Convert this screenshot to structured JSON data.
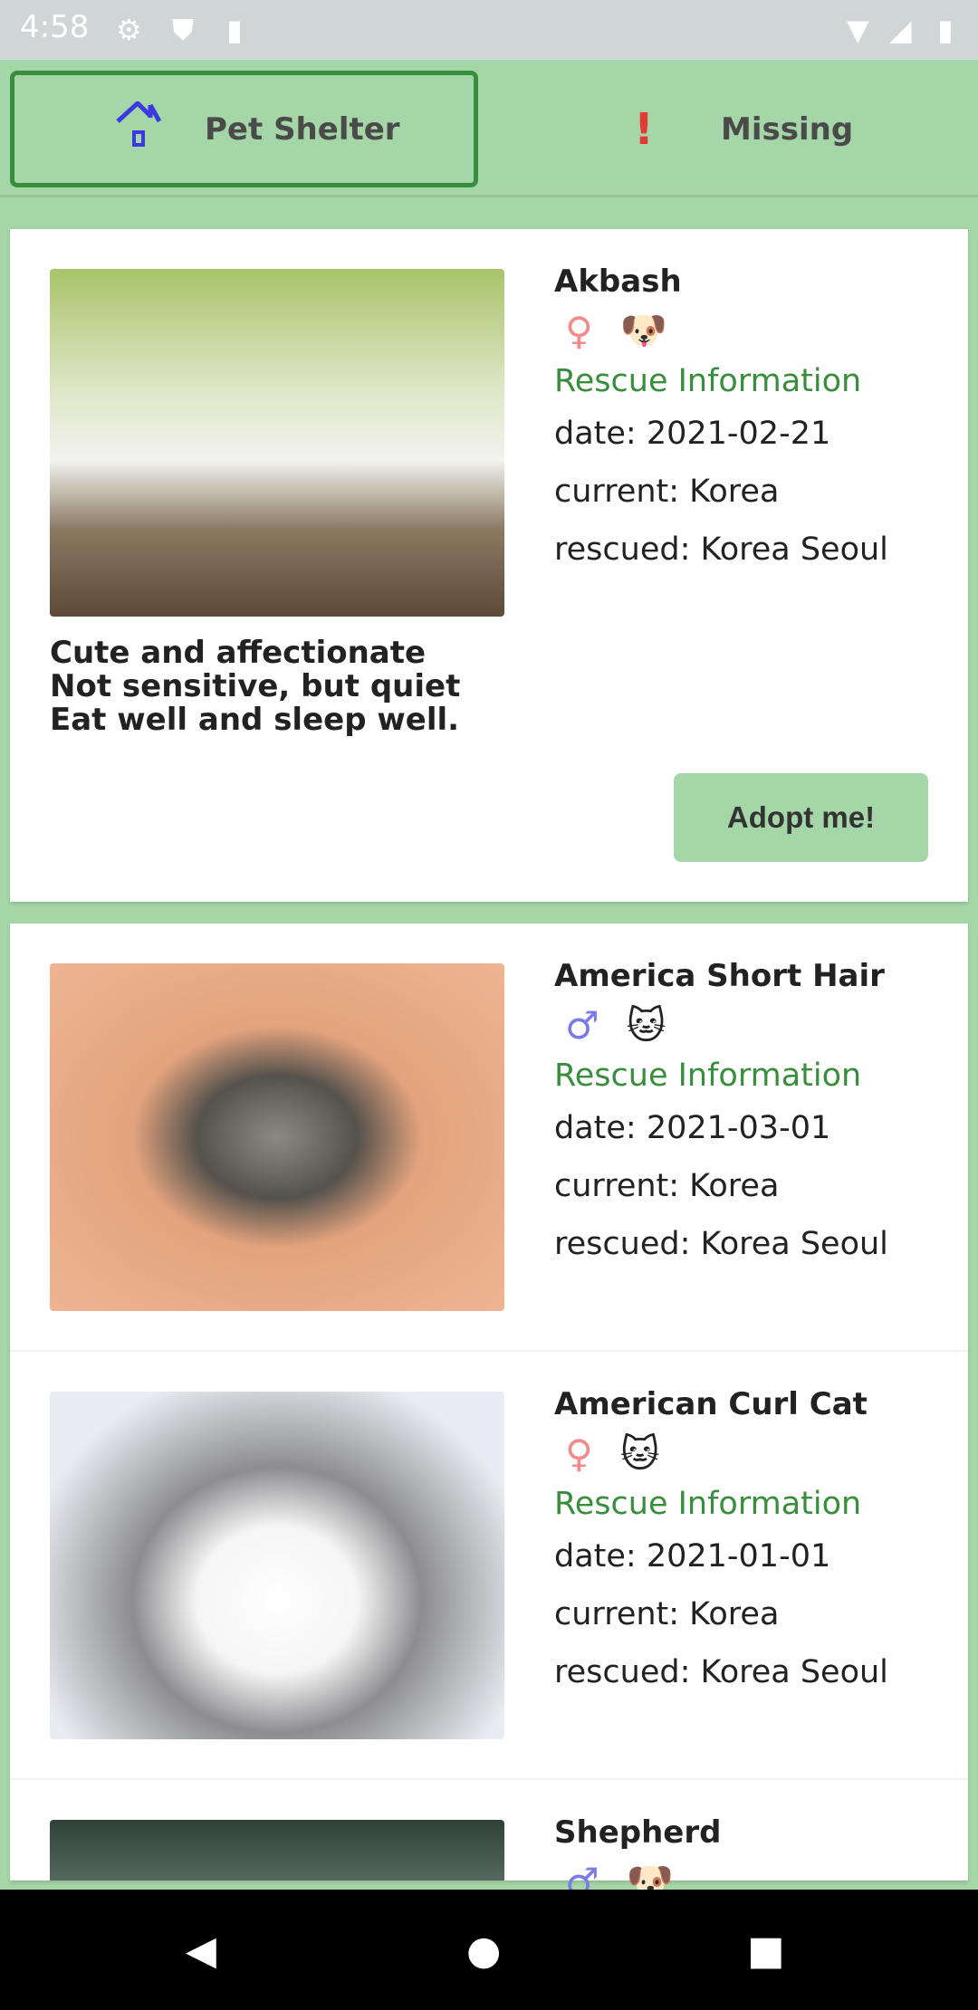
{
  "status_bar": {
    "time": "4:58",
    "icons": [
      "gear-icon",
      "shield-play-icon",
      "sd-card-icon",
      "wifi-icon",
      "signal-icon",
      "battery-icon"
    ]
  },
  "tabs": [
    {
      "label": "Pet Shelter",
      "icon": "house-icon",
      "selected": true
    },
    {
      "label": "Missing",
      "icon": "exclamation-icon",
      "selected": false
    }
  ],
  "colors": {
    "accent": "#a5d6a7",
    "selected_border": "#388e3c",
    "rescue_title": "#388e3c",
    "female": "#f48a8a",
    "male": "#7b7be8",
    "exclamation": "#e53935",
    "house": "#3a3ae0"
  },
  "featured": {
    "name": "Akbash",
    "gender": "♀",
    "species_icon": "🐶",
    "rescue_title": "Rescue Information",
    "date": "date: 2021-02-21",
    "current": "current: Korea",
    "rescued": "rescued: Korea Seoul",
    "description": [
      "Cute and affectionate",
      "Not sensitive, but quiet",
      "Eat well and sleep well."
    ],
    "adopt_label": "Adopt me!"
  },
  "pets": [
    {
      "name": "America Short Hair",
      "gender": "♂",
      "species_icon": "🐱",
      "rescue_title": "Rescue Information",
      "date": "date: 2021-03-01",
      "current": "current: Korea",
      "rescued": "rescued: Korea Seoul"
    },
    {
      "name": "American Curl Cat",
      "gender": "♀",
      "species_icon": "🐱",
      "rescue_title": "Rescue Information",
      "date": "date: 2021-01-01",
      "current": "current: Korea",
      "rescued": "rescued: Korea Seoul"
    },
    {
      "name": "Shepherd",
      "gender": "♂",
      "species_icon": "🐶"
    }
  ],
  "nav": {
    "back": "◀",
    "home": "●",
    "recents": "■"
  }
}
